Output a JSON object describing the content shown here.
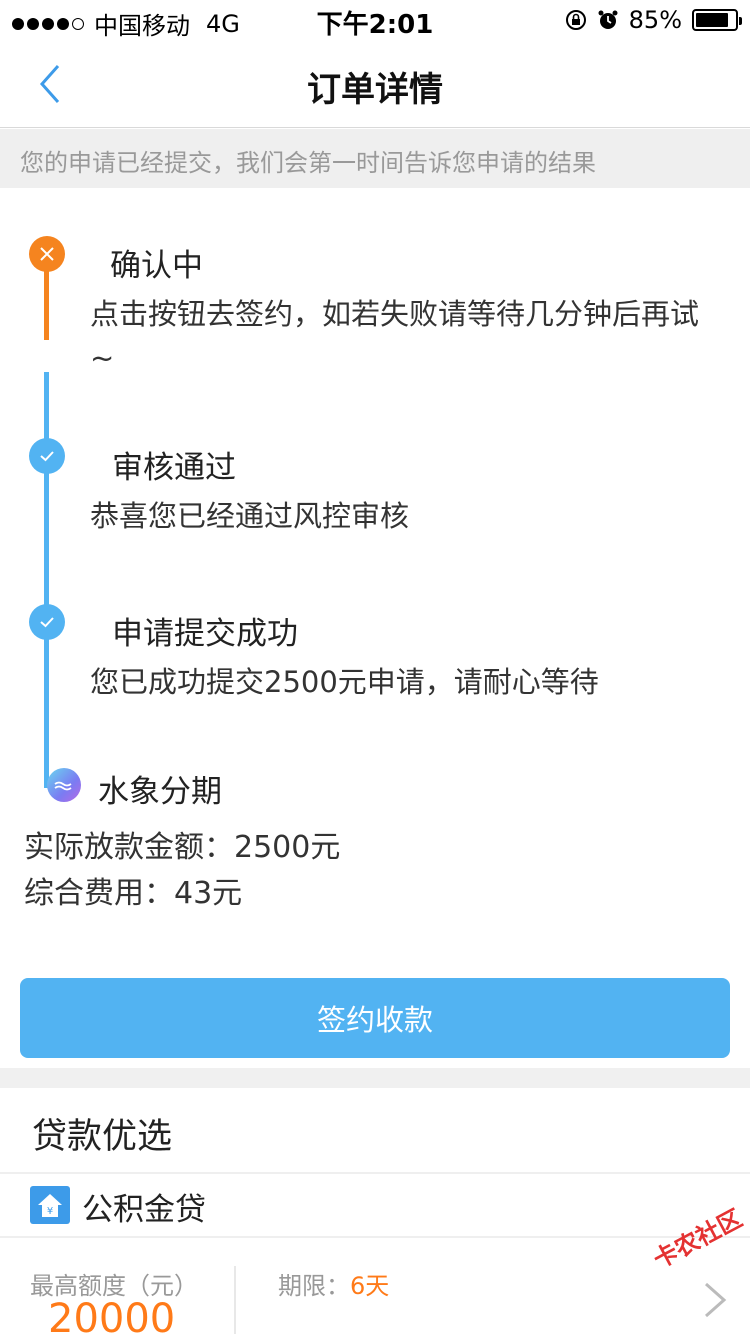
{
  "status_bar": {
    "carrier": "中国移动",
    "network": "4G",
    "time": "下午2:01",
    "battery": "85%",
    "battery_level": 0.85
  },
  "nav": {
    "title": "订单详情"
  },
  "notice": "您的申请已经提交，我们会第一时间告诉您申请的结果",
  "timeline": [
    {
      "title": "确认中",
      "desc_line1": "点击按钮去签约，如若失败请等待几分钟后再试",
      "desc_line2": "~",
      "status": "pending",
      "color": "#f5841f"
    },
    {
      "title": "审核通过",
      "desc": "恭喜您已经通过风控审核",
      "status": "done",
      "color": "#52b3f2"
    },
    {
      "title": "申请提交成功",
      "desc": "您已成功提交2500元申请，请耐心等待",
      "status": "done",
      "color": "#52b3f2"
    }
  ],
  "product": {
    "name": "水象分期",
    "amount_line": "实际放款金额：2500元",
    "fee_line": "综合费用：43元"
  },
  "sign_button": "签约收款",
  "loans_section": {
    "title": "贷款优选",
    "item": {
      "name": "公积金贷",
      "max_label": "最高额度（元）",
      "max_value": "20000",
      "term_label": "期限：",
      "term_value": "6天"
    }
  },
  "watermark": "卡农社区",
  "colors": {
    "accent_blue": "#52b3f2",
    "accent_orange": "#f5841f"
  }
}
